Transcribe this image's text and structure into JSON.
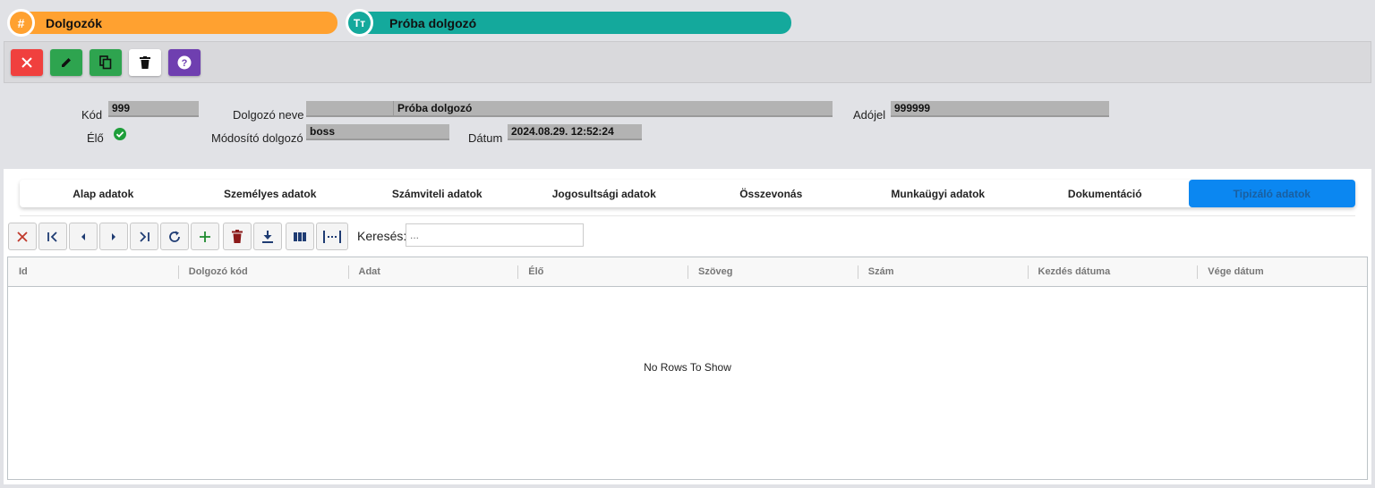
{
  "breadcrumb": [
    {
      "icon": "hash-icon",
      "glyph": "#",
      "label": "Dolgozók"
    },
    {
      "icon": "text-type-icon",
      "glyph": "Tт",
      "label": "Próba dolgozó"
    }
  ],
  "actions": [
    {
      "name": "close-button",
      "icon": "close-icon",
      "color": "#f0403e"
    },
    {
      "name": "edit-button",
      "icon": "pencil-icon",
      "color": "#2ea44f"
    },
    {
      "name": "copy-button",
      "icon": "copy-icon",
      "color": "#2ea44f"
    },
    {
      "name": "delete-button",
      "icon": "trash-icon",
      "color": "#ffffff"
    },
    {
      "name": "help-button",
      "icon": "help-icon",
      "color": "#6f3fb0"
    }
  ],
  "form": {
    "kod_label": "Kód",
    "kod_value": "999",
    "elo_label": "Élő",
    "elo_value": "check-circle-icon",
    "nev_label": "Dolgozó neve",
    "nev_value": "Próba dolgozó",
    "modosito_label": "Módosító dolgozó",
    "modosito_value": "boss",
    "datum_label": "Dátum",
    "datum_value": "2024.08.29. 12:52:24",
    "adojel_label": "Adójel",
    "adojel_value": "999999"
  },
  "tabs": [
    {
      "label": "Alap adatok",
      "active": false
    },
    {
      "label": "Személyes adatok",
      "active": false
    },
    {
      "label": "Számviteli adatok",
      "active": false
    },
    {
      "label": "Jogosultsági adatok",
      "active": false
    },
    {
      "label": "Összevonás",
      "active": false
    },
    {
      "label": "Munkaügyi adatok",
      "active": false
    },
    {
      "label": "Dokumentáció",
      "active": false
    },
    {
      "label": "Tipizáló adatok",
      "active": true
    }
  ],
  "grid_toolbar": {
    "buttons": [
      "clear-filter-icon",
      "first-page-icon",
      "prev-page-icon",
      "next-page-icon",
      "last-page-icon",
      "refresh-icon",
      "add-icon",
      "delete-icon",
      "download-icon",
      "columns-icon",
      "autosize-icon"
    ],
    "search_label": "Keresés:",
    "search_placeholder": "..."
  },
  "grid": {
    "columns": [
      "Id",
      "Dolgozó kód",
      "Adat",
      "Élő",
      "Szöveg",
      "Szám",
      "Kezdés dátuma",
      "Vége dátum"
    ],
    "empty_text": "No Rows To Show"
  }
}
